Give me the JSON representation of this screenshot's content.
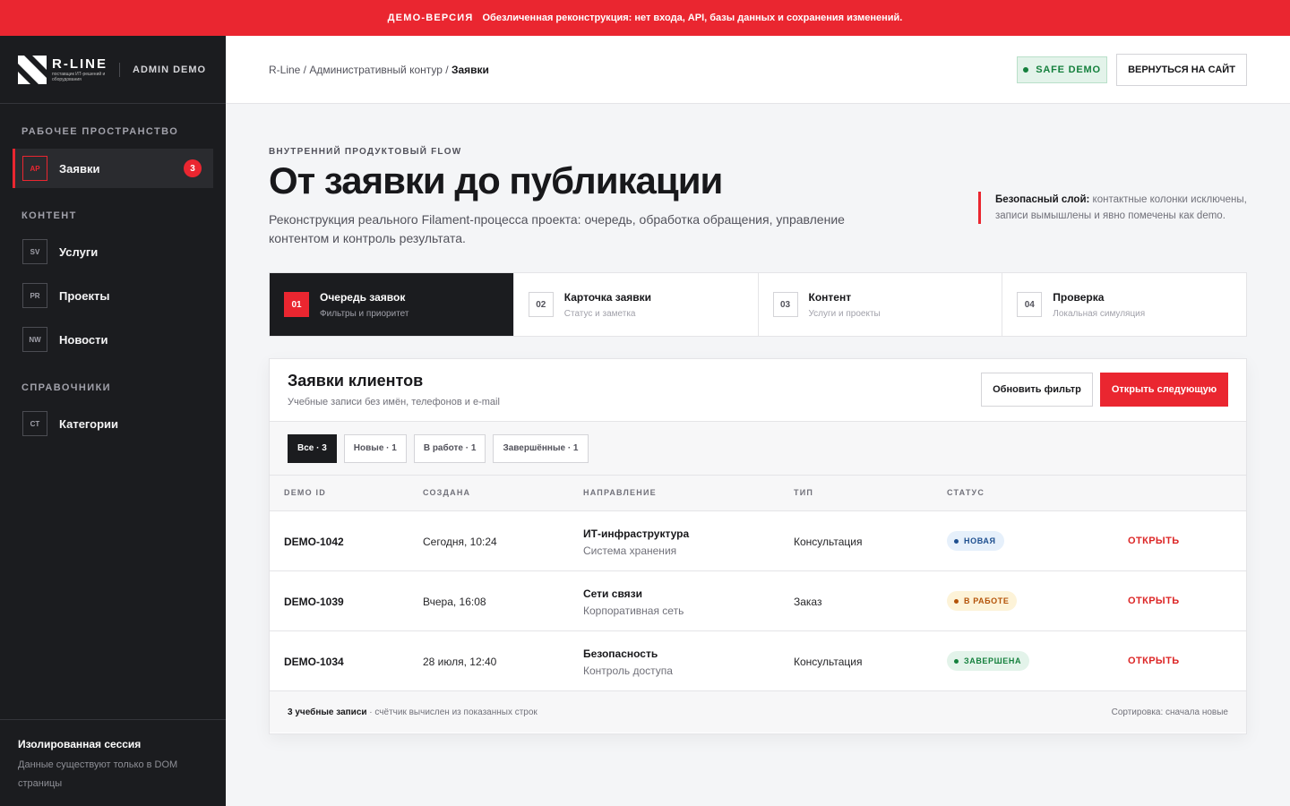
{
  "banner": {
    "tag": "ДЕМО-ВЕРСИЯ",
    "text": "Обезличенная реконструкция: нет входа, API, базы данных и сохранения изменений."
  },
  "brand": {
    "name": "R-LINE",
    "tagline": "поставщик ИТ-решений и оборудования",
    "admin_label": "ADMIN DEMO"
  },
  "sidebar": {
    "sections": [
      {
        "title": "РАБОЧЕЕ ПРОСТРАНСТВО"
      },
      {
        "title": "КОНТЕНТ"
      },
      {
        "title": "СПРАВОЧНИКИ"
      }
    ],
    "items": [
      {
        "code": "AP",
        "label": "Заявки",
        "badge": "3",
        "active": true
      },
      {
        "code": "SV",
        "label": "Услуги"
      },
      {
        "code": "PR",
        "label": "Проекты"
      },
      {
        "code": "NW",
        "label": "Новости"
      },
      {
        "code": "CT",
        "label": "Категории"
      }
    ],
    "session": {
      "title": "Изолированная сессия",
      "desc": "Данные существуют только в DOM страницы"
    }
  },
  "topbar": {
    "breadcrumb_path": "R-Line / Административный контур / ",
    "breadcrumb_current": "Заявки",
    "safe_badge": "SAFE DEMO",
    "back_button": "ВЕРНУТЬСЯ НА САЙТ"
  },
  "hero": {
    "eyebrow": "ВНУТРЕННИЙ ПРОДУКТОВЫЙ FLOW",
    "title": "От заявки до публикации",
    "desc": "Реконструкция реального Filament-процесса проекта: очередь, обработка обращения, управление контентом и контроль результата.",
    "note_bold": "Безопасный слой:",
    "note_text": " контактные колонки исключены, записи вымышлены и явно помечены как demo."
  },
  "steps": [
    {
      "num": "01",
      "title": "Очередь заявок",
      "sub": "Фильтры и приоритет",
      "active": true
    },
    {
      "num": "02",
      "title": "Карточка заявки",
      "sub": "Статус и заметка"
    },
    {
      "num": "03",
      "title": "Контент",
      "sub": "Услуги и проекты"
    },
    {
      "num": "04",
      "title": "Проверка",
      "sub": "Локальная симуляция"
    }
  ],
  "card": {
    "title": "Заявки клиентов",
    "subtitle": "Учебные записи без имён, телефонов и e-mail",
    "refresh_button": "Обновить фильтр",
    "next_button": "Открыть следующую",
    "filters": [
      {
        "label": "Все · 3",
        "active": true
      },
      {
        "label": "Новые · 1"
      },
      {
        "label": "В работе · 1"
      },
      {
        "label": "Завершённые · 1"
      }
    ],
    "columns": [
      "DEMO ID",
      "СОЗДАНА",
      "НАПРАВЛЕНИЕ",
      "ТИП",
      "СТАТУС"
    ],
    "rows": [
      {
        "id": "DEMO-1042",
        "date": "Сегодня, 10:24",
        "dir": "ИТ-инфраструктура",
        "dir_sub": "Система хранения",
        "type": "Консультация",
        "status": "НОВАЯ",
        "status_kind": "new",
        "action": "ОТКРЫТЬ"
      },
      {
        "id": "DEMO-1039",
        "date": "Вчера, 16:08",
        "dir": "Сети связи",
        "dir_sub": "Корпоративная сеть",
        "type": "Заказ",
        "status": "В РАБОТЕ",
        "status_kind": "work",
        "action": "ОТКРЫТЬ"
      },
      {
        "id": "DEMO-1034",
        "date": "28 июля, 12:40",
        "dir": "Безопасность",
        "dir_sub": "Контроль доступа",
        "type": "Консультация",
        "status": "ЗАВЕРШЕНА",
        "status_kind": "done",
        "action": "ОТКРЫТЬ"
      }
    ],
    "footer_count": "3 учебные записи",
    "footer_note": " · счётчик вычислен из показанных строк",
    "footer_sort": "Сортировка: сначала новые"
  },
  "colors": {
    "accent": "#ea2630",
    "sidebar_bg": "#1b1c1f",
    "status_new": "#1e4f8f",
    "status_work": "#b45309",
    "status_done": "#15803d"
  }
}
